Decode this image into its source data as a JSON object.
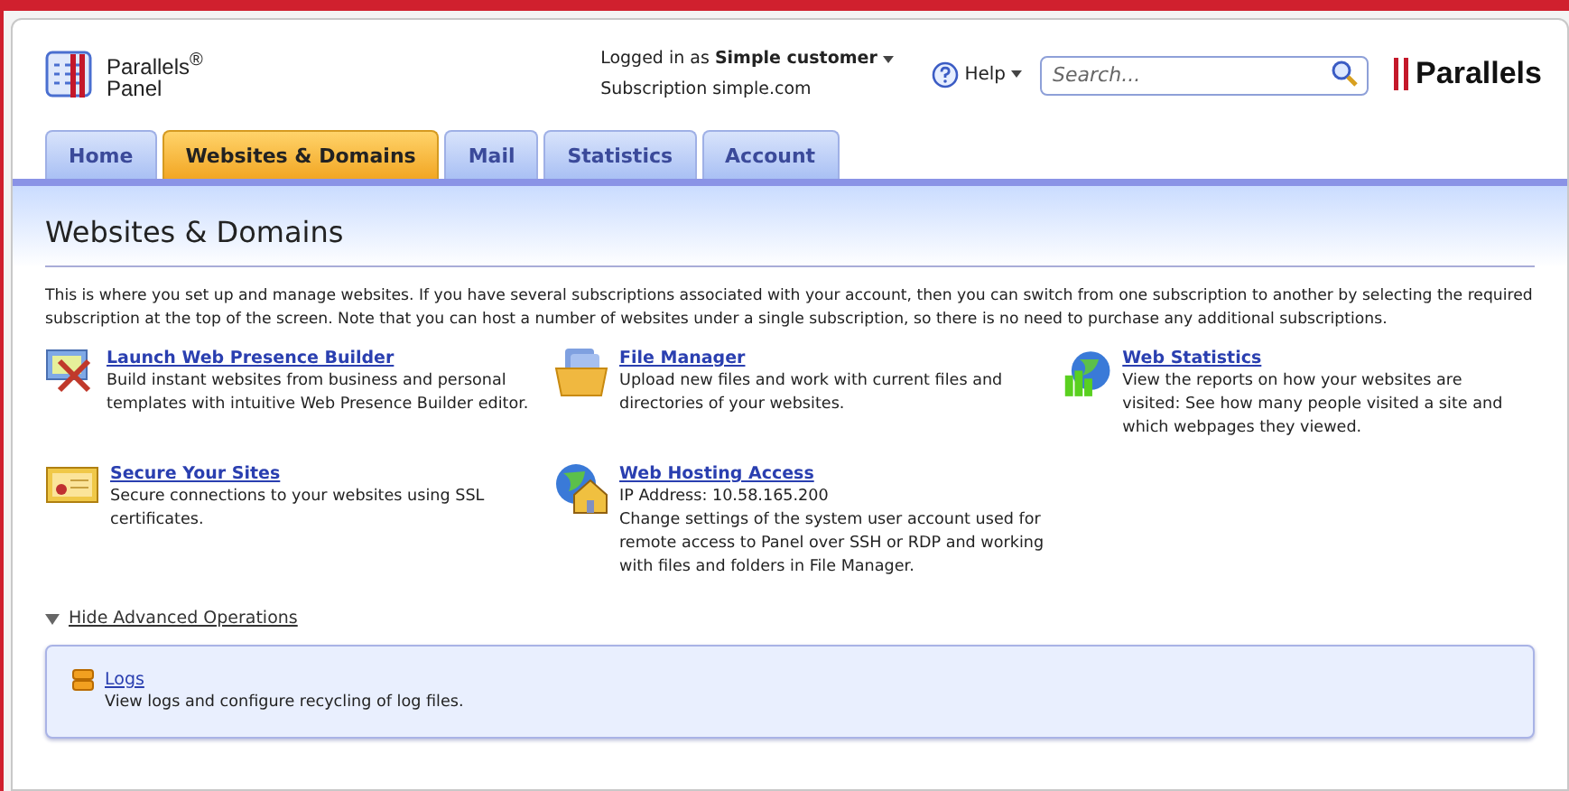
{
  "logo": {
    "line1": "Parallels$^{®}$",
    "line2": "Panel"
  },
  "user": {
    "prefix": "Logged in as",
    "name": "Simple customer",
    "subscription_label": "Subscription",
    "subscription": "simple.com"
  },
  "help": "Help",
  "search": {
    "placeholder": "Search..."
  },
  "brand": "Parallels",
  "tabs": [
    {
      "label": "Home",
      "selected": false
    },
    {
      "label": "Websites & Domains",
      "selected": true
    },
    {
      "label": "Mail",
      "selected": false
    },
    {
      "label": "Statistics",
      "selected": false
    },
    {
      "label": "Account",
      "selected": false
    }
  ],
  "page_title": "Websites & Domains",
  "intro": "This is where you set up and manage websites. If you have several subscriptions associated with your account, then you can switch from one subscription to another by selecting the required subscription at the top of the screen. Note that you can host a number of websites under a single subscription, so there is no need to purchase any additional subscriptions.",
  "operations": [
    {
      "title": "Launch Web Presence Builder",
      "lines": [
        "Build instant websites from business and personal templates with intuitive Web Presence Builder editor."
      ]
    },
    {
      "title": "File Manager",
      "lines": [
        "Upload new files and work with current files and directories of your websites."
      ]
    },
    {
      "title": "Web Statistics",
      "lines": [
        "View the reports on how your websites are visited: See how many people visited a site and which webpages they viewed."
      ]
    },
    {
      "title": "Secure Your Sites",
      "lines": [
        "Secure connections to your websites using SSL certificates."
      ]
    },
    {
      "title": "Web Hosting Access",
      "lines": [
        "IP Address: 10.58.165.200",
        "Change settings of the system user account used for remote access to Panel over SSH or RDP and working with files and folders in File Manager."
      ]
    }
  ],
  "advanced": {
    "toggle": "Hide Advanced Operations",
    "expanded": true,
    "items": [
      {
        "title": "Logs",
        "lines": [
          "View logs and configure recycling of log files."
        ]
      }
    ]
  }
}
